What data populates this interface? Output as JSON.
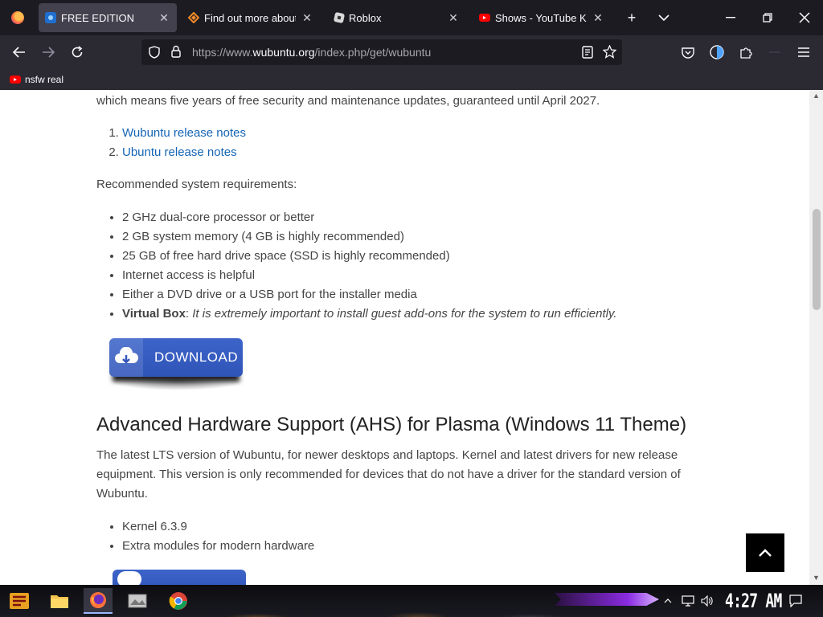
{
  "tabs": [
    {
      "title": "FREE EDITION",
      "icon": "edition-icon",
      "active": true
    },
    {
      "title": "Find out more about W",
      "icon": "diamond-icon",
      "active": false
    },
    {
      "title": "Roblox",
      "icon": "roblox-icon",
      "active": false
    },
    {
      "title": "Shows - YouTube Kids",
      "icon": "youtube-icon",
      "active": false
    }
  ],
  "tab_close_glyph": "✕",
  "url": {
    "scheme": "https://www.",
    "domain": "wubuntu.org",
    "path": "/index.php/get/wubuntu"
  },
  "bookmarks": [
    {
      "label": "nsfw real",
      "icon": "youtube-icon"
    }
  ],
  "page": {
    "lead": "which means five years of free security and maintenance updates, guaranteed until April 2027.",
    "release_notes": [
      "Wubuntu release notes",
      "Ubuntu release notes"
    ],
    "requirements_title": "Recommended system requirements:",
    "requirements": [
      "2 GHz dual-core processor or better",
      "2 GB system memory (4 GB is highly recommended)",
      "25 GB of free hard drive space (SSD is highly recommended)",
      "Internet access is helpful",
      "Either a DVD drive or a USB port for the installer media"
    ],
    "vbox_label": "Virtual Box",
    "vbox_note": "It is extremely important to install guest add-ons for the system to run efficiently.",
    "download_label": "DOWNLOAD",
    "ahs_heading": "Advanced Hardware Support (AHS) for Plasma (Windows 11 Theme)",
    "ahs_desc": "The latest LTS version of Wubuntu, for newer desktops and laptops. Kernel and latest drivers for new release equipment. This version is only recommended for devices that do not have a driver for the standard version of Wubuntu.",
    "ahs_items": [
      "Kernel 6.3.9",
      "Extra modules for modern hardware"
    ]
  },
  "taskbar": {
    "clock": "4:27 AM"
  },
  "colors": {
    "link": "#1565b5",
    "download_button": "#3458be",
    "purple_accent": "#8a2be2"
  }
}
